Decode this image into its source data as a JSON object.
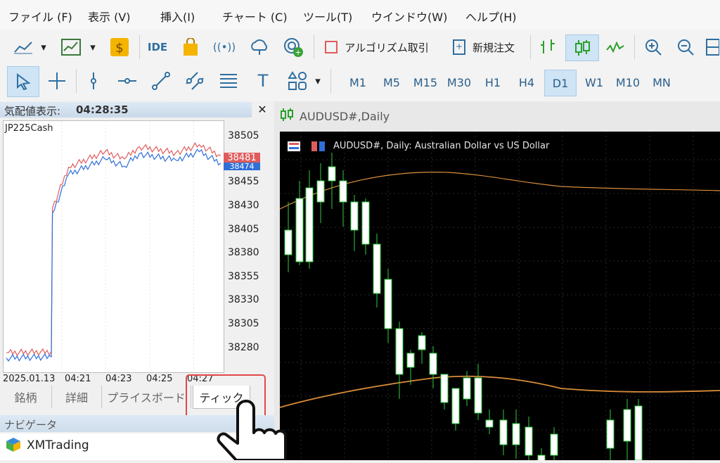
{
  "menu": [
    "ファイル (F)",
    "表示 (V)",
    "挿入(I)",
    "チャート (C)",
    "ツール(T)",
    "ウインドウ(W)",
    "ヘルプ(H)"
  ],
  "toolbar1": {
    "ide_label": "IDE",
    "algo_label": "アルゴリズム取引",
    "new_order_label": "新規注文"
  },
  "toolbar2": {
    "timeframes": [
      "M1",
      "M5",
      "M15",
      "M30",
      "H1",
      "H4",
      "D1",
      "W1",
      "M10",
      "MN"
    ],
    "active_timeframe": "D1"
  },
  "quote_panel": {
    "title_label": "気配値表示: ",
    "time": "04:28:35",
    "symbol": "JP225Cash",
    "y_ticks": [
      "38505",
      "38480",
      "38455",
      "38430",
      "38405",
      "38380",
      "38355",
      "38330",
      "38305",
      "38280"
    ],
    "x_ticks": [
      "2025.01.13",
      "04:21",
      "04:23",
      "04:25",
      "04:27"
    ],
    "ask_price": "38481",
    "bid_price": "38474",
    "ask_color": "#e05c5c",
    "bid_color": "#2f6fd8"
  },
  "panel_tabs": [
    "銘柄",
    "詳細",
    "プライスボード",
    "ティック"
  ],
  "active_panel_tab": "ティック",
  "navigator": {
    "title": "ナビゲータ",
    "broker": "XMTrading"
  },
  "chart": {
    "tab_label": "AUDUSD#,Daily",
    "caption": "AUDUSD#, Daily:  Australian Dollar vs US Dollar",
    "ma_color": "#d98c3a",
    "bull_color": "#ffffff",
    "bear_color": "#000000",
    "wick_color": "#2ecc40"
  },
  "chart_data": {
    "type": "line",
    "title": "",
    "xlabel": "",
    "ylabel": "",
    "categories": [
      "2025.01.13",
      "04:21",
      "04:23",
      "04:25",
      "04:27"
    ],
    "ylim": [
      38270,
      38515
    ],
    "series": [
      {
        "name": "",
        "values": [
          38289,
          38290,
          38430,
          38470,
          38485,
          38478,
          38490,
          38484,
          38492,
          38481
        ]
      },
      {
        "name": "",
        "values": [
          38284,
          38285,
          38425,
          38463,
          38478,
          38471,
          38483,
          38477,
          38485,
          38474
        ]
      }
    ]
  }
}
